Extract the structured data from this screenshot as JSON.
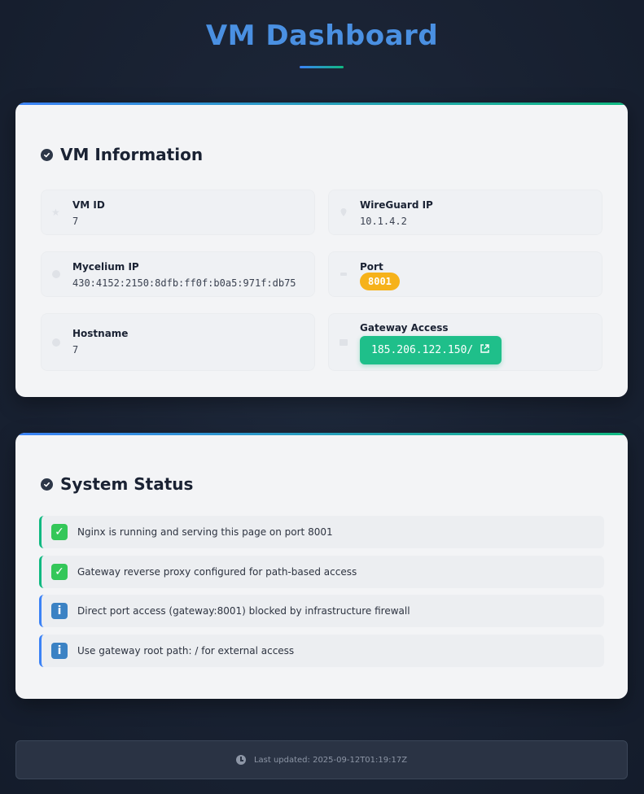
{
  "page": {
    "title": "VM Dashboard",
    "accent_color": "#4a90e2",
    "gradient_colors": [
      "#3b82f6",
      "#10b981"
    ]
  },
  "vm_info": {
    "title": "VM Information",
    "header_icon": "check-circle-icon",
    "items": [
      {
        "label": "VM ID",
        "value": "7",
        "icon": "star-icon"
      },
      {
        "label": "WireGuard IP",
        "value": "10.1.4.2",
        "icon": "map-pin-icon"
      },
      {
        "label": "Mycelium IP",
        "value": "430:4152:2150:8dfb:ff0f:b0a5:971f:db75",
        "icon": "globe-icon"
      },
      {
        "label": "Port",
        "value": "8001",
        "icon": "plug-icon",
        "badge_color": "#f6b21a"
      },
      {
        "label": "Hostname",
        "value": "7",
        "icon": "server-icon"
      },
      {
        "label": "Gateway Access",
        "value": "185.206.122.150/",
        "icon": "gateway-icon",
        "link_icon": "external-link-icon",
        "button_color": "#1fbf8a"
      }
    ]
  },
  "system_status": {
    "title": "System Status",
    "header_icon": "check-circle-icon",
    "items": [
      {
        "type": "success",
        "icon": "check-mark-icon",
        "text": "Nginx is running and serving this page on port 8001"
      },
      {
        "type": "success",
        "icon": "check-mark-icon",
        "text": "Gateway reverse proxy configured for path-based access"
      },
      {
        "type": "info",
        "icon": "info-icon",
        "text": "Direct port access (gateway:8001) blocked by infrastructure firewall"
      },
      {
        "type": "info",
        "icon": "info-icon",
        "text": "Use gateway root path: / for external access"
      }
    ]
  },
  "footer": {
    "icon": "clock-icon",
    "text": "Last updated: 2025-09-12T01:19:17Z"
  }
}
